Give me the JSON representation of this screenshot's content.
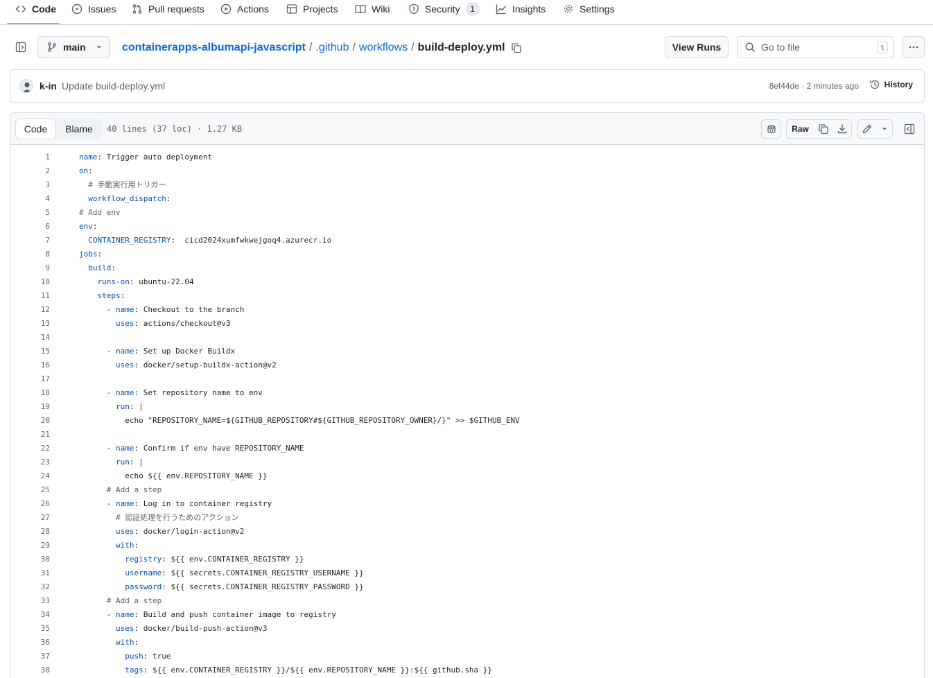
{
  "repo_nav": {
    "code": "Code",
    "issues": "Issues",
    "pull_requests": "Pull requests",
    "actions": "Actions",
    "projects": "Projects",
    "wiki": "Wiki",
    "security": "Security",
    "security_count": "1",
    "insights": "Insights",
    "settings": "Settings"
  },
  "path_bar": {
    "branch": "main",
    "breadcrumb": [
      "containerapps-albumapi-javascript",
      ".github",
      "workflows"
    ],
    "separator": "/",
    "filename": "build-deploy.yml",
    "view_runs": "View Runs",
    "search_placeholder": "Go to file",
    "search_shortcut": "t"
  },
  "commit": {
    "author": "k-in",
    "message": "Update build-deploy.yml",
    "meta": "8ef44de · 2 minutes ago",
    "history": "History"
  },
  "file_header": {
    "tab_code": "Code",
    "tab_blame": "Blame",
    "info": "40 lines (37 loc) · 1.27 KB",
    "raw": "Raw"
  },
  "code_lines": [
    [
      [
        "k",
        "name"
      ],
      [
        "p",
        ": Trigger auto deployment"
      ]
    ],
    [
      [
        "k",
        "on"
      ],
      [
        "p",
        ":"
      ]
    ],
    [
      [
        "c",
        "  # 手動実行用トリガー"
      ]
    ],
    [
      [
        "p",
        "  "
      ],
      [
        "k",
        "workflow_dispatch"
      ],
      [
        "p",
        ":"
      ]
    ],
    [
      [
        "c",
        "# Add env"
      ]
    ],
    [
      [
        "k",
        "env"
      ],
      [
        "p",
        ":"
      ]
    ],
    [
      [
        "p",
        "  "
      ],
      [
        "k",
        "CONTAINER_REGISTRY"
      ],
      [
        "p",
        ":  cicd2024xumfwkwejgoq4.azurecr.io"
      ]
    ],
    [
      [
        "k",
        "jobs"
      ],
      [
        "p",
        ":"
      ]
    ],
    [
      [
        "p",
        "  "
      ],
      [
        "k",
        "build"
      ],
      [
        "p",
        ":"
      ]
    ],
    [
      [
        "p",
        "    "
      ],
      [
        "k",
        "runs-on"
      ],
      [
        "p",
        ": ubuntu-22.04"
      ]
    ],
    [
      [
        "p",
        "    "
      ],
      [
        "k",
        "steps"
      ],
      [
        "p",
        ":"
      ]
    ],
    [
      [
        "p",
        "      - "
      ],
      [
        "k",
        "name"
      ],
      [
        "p",
        ": Checkout to the branch"
      ]
    ],
    [
      [
        "p",
        "        "
      ],
      [
        "k",
        "uses"
      ],
      [
        "p",
        ": actions/checkout@v3"
      ]
    ],
    [],
    [
      [
        "p",
        "      - "
      ],
      [
        "k",
        "name"
      ],
      [
        "p",
        ": Set up Docker Buildx"
      ]
    ],
    [
      [
        "p",
        "        "
      ],
      [
        "k",
        "uses"
      ],
      [
        "p",
        ": docker/setup-buildx-action@v2"
      ]
    ],
    [],
    [
      [
        "p",
        "      - "
      ],
      [
        "k",
        "name"
      ],
      [
        "p",
        ": Set repository name to env"
      ]
    ],
    [
      [
        "p",
        "        "
      ],
      [
        "k",
        "run"
      ],
      [
        "p",
        ": |"
      ]
    ],
    [
      [
        "p",
        "          echo \"REPOSITORY_NAME=${GITHUB_REPOSITORY#${GITHUB_REPOSITORY_OWNER}/}\" >> $GITHUB_ENV"
      ]
    ],
    [],
    [
      [
        "p",
        "      - "
      ],
      [
        "k",
        "name"
      ],
      [
        "p",
        ": Confirm if env have REPOSITORY_NAME"
      ]
    ],
    [
      [
        "p",
        "        "
      ],
      [
        "k",
        "run"
      ],
      [
        "p",
        ": |"
      ]
    ],
    [
      [
        "p",
        "          echo ${{ env.REPOSITORY_NAME }}"
      ]
    ],
    [
      [
        "c",
        "      # Add a step"
      ]
    ],
    [
      [
        "p",
        "      - "
      ],
      [
        "k",
        "name"
      ],
      [
        "p",
        ": Log in to container registry"
      ]
    ],
    [
      [
        "c",
        "        # 認証処理を行うためのアクション"
      ]
    ],
    [
      [
        "p",
        "        "
      ],
      [
        "k",
        "uses"
      ],
      [
        "p",
        ": docker/login-action@v2"
      ]
    ],
    [
      [
        "p",
        "        "
      ],
      [
        "k",
        "with"
      ],
      [
        "p",
        ":"
      ]
    ],
    [
      [
        "p",
        "          "
      ],
      [
        "k",
        "registry"
      ],
      [
        "p",
        ": ${{ env.CONTAINER_REGISTRY }}"
      ]
    ],
    [
      [
        "p",
        "          "
      ],
      [
        "k",
        "username"
      ],
      [
        "p",
        ": ${{ secrets.CONTAINER_REGISTRY_USERNAME }}"
      ]
    ],
    [
      [
        "p",
        "          "
      ],
      [
        "k",
        "password"
      ],
      [
        "p",
        ": ${{ secrets.CONTAINER_REGISTRY_PASSWORD }}"
      ]
    ],
    [
      [
        "c",
        "      # Add a step"
      ]
    ],
    [
      [
        "p",
        "      - "
      ],
      [
        "k",
        "name"
      ],
      [
        "p",
        ": Build and push container image to registry"
      ]
    ],
    [
      [
        "p",
        "        "
      ],
      [
        "k",
        "uses"
      ],
      [
        "p",
        ": docker/build-push-action@v3"
      ]
    ],
    [
      [
        "p",
        "        "
      ],
      [
        "k",
        "with"
      ],
      [
        "p",
        ":"
      ]
    ],
    [
      [
        "p",
        "          "
      ],
      [
        "k",
        "push"
      ],
      [
        "p",
        ": true"
      ]
    ],
    [
      [
        "p",
        "          "
      ],
      [
        "k",
        "tags"
      ],
      [
        "p",
        ": ${{ env.CONTAINER_REGISTRY }}/${{ env.REPOSITORY_NAME }}:${{ github.sha }}"
      ]
    ]
  ]
}
